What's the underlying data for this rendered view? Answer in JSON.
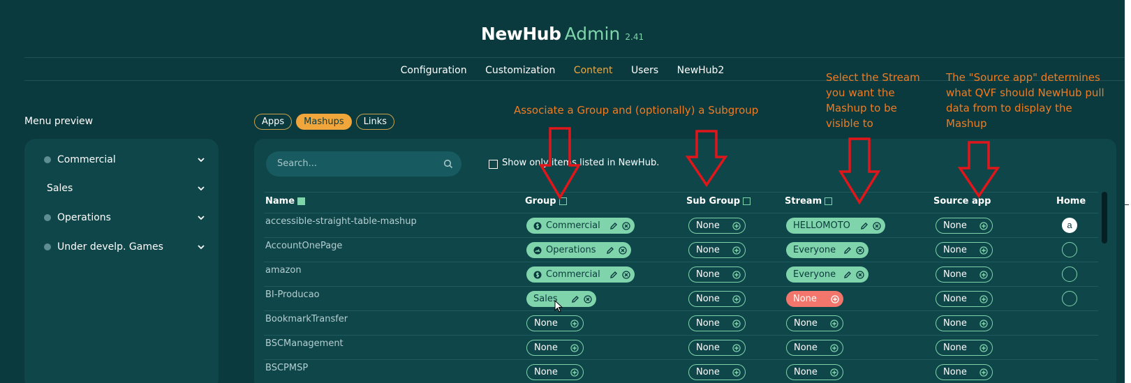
{
  "header": {
    "brand_bold": "NewHub",
    "brand_light": "Admin",
    "version": "2.41"
  },
  "nav": {
    "items": [
      "Configuration",
      "Customization",
      "Content",
      "Users",
      "NewHub2"
    ],
    "active": "Content"
  },
  "menu_preview": {
    "title": "Menu preview",
    "items": [
      {
        "label": "Commercial",
        "icon": "dollar-icon"
      },
      {
        "label": "Sales",
        "icon": ""
      },
      {
        "label": "Operations",
        "icon": "gauge-icon"
      },
      {
        "label": "Under develp. Games",
        "icon": "gauge-icon"
      }
    ]
  },
  "tabs": [
    "Apps",
    "Mashups",
    "Links"
  ],
  "active_tab": "Mashups",
  "search": {
    "placeholder": "Search..."
  },
  "filter": {
    "label": "Show only items listed in NewHub.",
    "checked": false
  },
  "columns": [
    "Name",
    "Group",
    "Sub Group",
    "Stream",
    "Source app",
    "Home"
  ],
  "rows": [
    {
      "name": "accessible-straight-table-mashup",
      "group": "Commercial",
      "group_icon": "dollar-icon",
      "subgroup": "None",
      "stream": "HELLOMOTO",
      "source": "None",
      "home": "a"
    },
    {
      "name": "AccountOnePage",
      "group": "Operations",
      "group_icon": "gauge-icon",
      "subgroup": "None",
      "stream": "Everyone",
      "source": "None",
      "home": ""
    },
    {
      "name": "amazon",
      "group": "Commercial",
      "group_icon": "dollar-icon",
      "subgroup": "None",
      "stream": "Everyone",
      "source": "None",
      "home": ""
    },
    {
      "name": "BI-Producao",
      "group": "Sales",
      "group_icon": "",
      "subgroup": "None",
      "stream": "None",
      "source": "None",
      "home": ""
    },
    {
      "name": "BookmarkTransfer",
      "group": "None",
      "group_icon": "",
      "subgroup": "None",
      "stream": "None",
      "source": "None",
      "home": null
    },
    {
      "name": "BSCManagement",
      "group": "None",
      "group_icon": "",
      "subgroup": "None",
      "stream": "None",
      "source": "None",
      "home": null
    },
    {
      "name": "BSCPMSP",
      "group": "None",
      "group_icon": "",
      "subgroup": "None",
      "stream": "None",
      "source": "None",
      "home": null
    }
  ],
  "annotations": [
    "Associate a Group and (optionally) a Subgroup",
    "Select the Stream you want the Mashup to be visible to",
    "The \"Source app\" determines what QVF should NewHub pull data from to display the Mashup"
  ],
  "colors": {
    "background": "#0b3a3e",
    "panel": "#0f464a",
    "accent": "#7fd4ab",
    "active_nav": "#f0a63a",
    "alert": "#f2766b",
    "annotation": "#f07c22"
  }
}
